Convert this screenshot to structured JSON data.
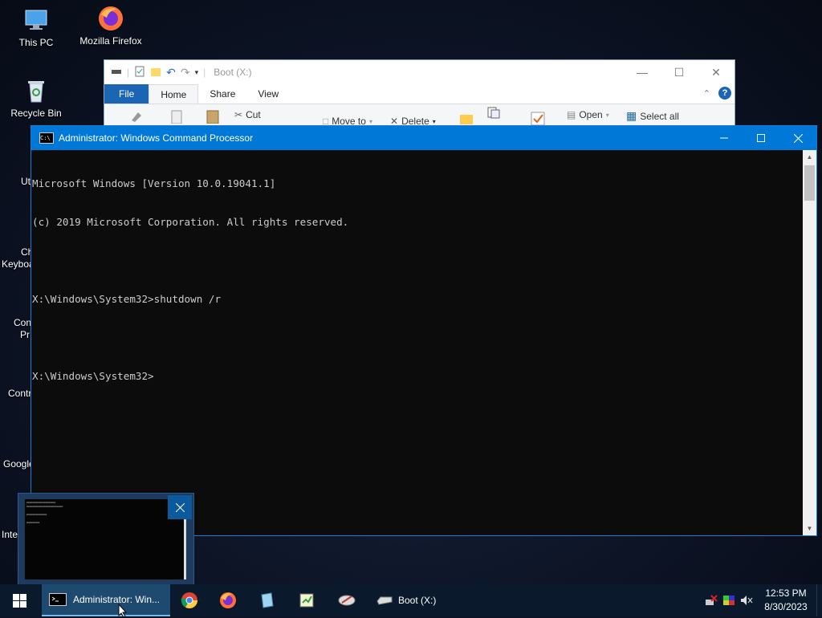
{
  "desktop": {
    "icons": [
      {
        "label": "This PC",
        "icon": "this-pc-icon"
      },
      {
        "label": "Mozilla Firefox",
        "icon": "firefox-icon"
      },
      {
        "label": "Recycle Bin",
        "icon": "recycle-bin-icon"
      }
    ],
    "partial_labels": [
      "Ut",
      "Ch",
      "Keyboa",
      "Con",
      "Pr",
      "Contr",
      "Google",
      "Inte"
    ]
  },
  "explorer": {
    "title": "Boot (X:)",
    "tabs": [
      "File",
      "Home",
      "Share",
      "View"
    ],
    "active_tab": "Home",
    "ribbon": {
      "cut": "Cut",
      "move_to": "Move to",
      "delete": "Delete",
      "open": "Open",
      "select_all": "Select all"
    },
    "help": "?"
  },
  "cmd": {
    "title": "Administrator: Windows Command Processor",
    "lines": [
      "Microsoft Windows [Version 10.0.19041.1]",
      "(c) 2019 Microsoft Corporation. All rights reserved.",
      "",
      "X:\\Windows\\System32>shutdown /r",
      "",
      "X:\\Windows\\System32>"
    ]
  },
  "taskbar": {
    "cmd_label": "Administrator: Win...",
    "boot_label": "Boot (X:)",
    "pinned": [
      "chrome-icon",
      "firefox-icon",
      "notepad-icon",
      "editor-icon",
      "tool-icon"
    ],
    "clock": {
      "time": "12:53 PM",
      "date": "8/30/2023"
    }
  },
  "colors": {
    "accent": "#0078d7",
    "ribbon_file": "#1a66b5",
    "console_text": "#cccccc",
    "console_bg": "#0c0c0c"
  }
}
